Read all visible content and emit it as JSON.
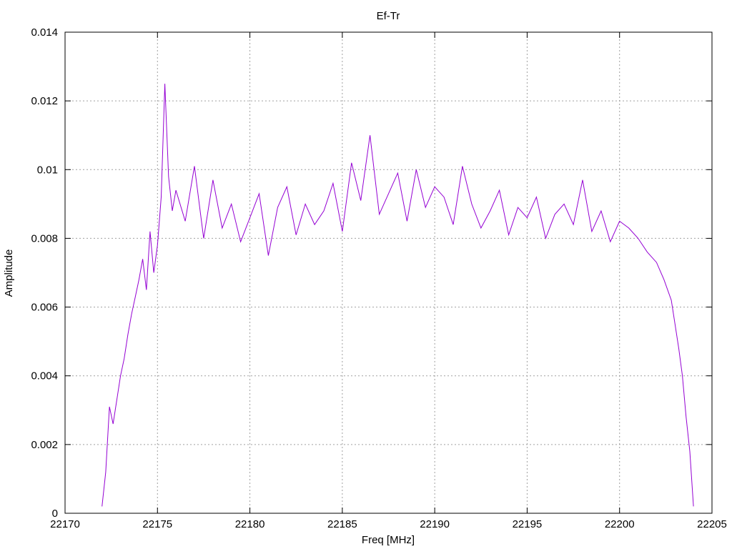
{
  "chart_data": {
    "type": "line",
    "title": "Ef-Tr",
    "xlabel": "Freq [MHz]",
    "ylabel": "Amplitude",
    "xlim": [
      22170,
      22205
    ],
    "ylim": [
      0,
      0.014
    ],
    "xticks": [
      22170,
      22175,
      22180,
      22185,
      22190,
      22195,
      22200,
      22205
    ],
    "xtick_labels": [
      "22170",
      "22175",
      "22180",
      "22185",
      "22190",
      "22195",
      "22200",
      "22205"
    ],
    "yticks": [
      0,
      0.002,
      0.004,
      0.006,
      0.008,
      0.01,
      0.012,
      0.014
    ],
    "ytick_labels": [
      "0",
      "0.002",
      "0.004",
      "0.006",
      "0.008",
      "0.01",
      "0.012",
      "0.014"
    ],
    "grid": true,
    "series": [
      {
        "color": "#9400d3",
        "x": [
          22172.0,
          22172.2,
          22172.4,
          22172.6,
          22172.8,
          22173.0,
          22173.2,
          22173.4,
          22173.6,
          22173.8,
          22174.0,
          22174.2,
          22174.4,
          22174.6,
          22174.8,
          22175.0,
          22175.2,
          22175.4,
          22175.6,
          22175.8,
          22176.0,
          22176.5,
          22177.0,
          22177.5,
          22178.0,
          22178.5,
          22179.0,
          22179.5,
          22180.0,
          22180.5,
          22181.0,
          22181.5,
          22182.0,
          22182.5,
          22183.0,
          22183.5,
          22184.0,
          22184.5,
          22185.0,
          22185.5,
          22186.0,
          22186.5,
          22187.0,
          22187.5,
          22188.0,
          22188.5,
          22189.0,
          22189.5,
          22190.0,
          22190.5,
          22191.0,
          22191.5,
          22192.0,
          22192.5,
          22193.0,
          22193.5,
          22194.0,
          22194.5,
          22195.0,
          22195.5,
          22196.0,
          22196.5,
          22197.0,
          22197.5,
          22198.0,
          22198.5,
          22199.0,
          22199.5,
          22200.0,
          22200.5,
          22201.0,
          22201.5,
          22202.0,
          22202.4,
          22202.8,
          22203.0,
          22203.2,
          22203.4,
          22203.6,
          22203.8,
          22204.0
        ],
        "y": [
          0.0002,
          0.0012,
          0.0031,
          0.0026,
          0.0033,
          0.004,
          0.0045,
          0.0052,
          0.0058,
          0.0063,
          0.0068,
          0.0074,
          0.0065,
          0.0082,
          0.007,
          0.0078,
          0.0092,
          0.0125,
          0.0098,
          0.0088,
          0.0094,
          0.0085,
          0.0101,
          0.008,
          0.0097,
          0.0083,
          0.009,
          0.0079,
          0.0086,
          0.0093,
          0.0075,
          0.0089,
          0.0095,
          0.0081,
          0.009,
          0.0084,
          0.0088,
          0.0096,
          0.0082,
          0.0102,
          0.0091,
          0.011,
          0.0087,
          0.0093,
          0.0099,
          0.0085,
          0.01,
          0.0089,
          0.0095,
          0.0092,
          0.0084,
          0.0101,
          0.009,
          0.0083,
          0.0088,
          0.0094,
          0.0081,
          0.0089,
          0.0086,
          0.0092,
          0.008,
          0.0087,
          0.009,
          0.0084,
          0.0097,
          0.0082,
          0.0088,
          0.0079,
          0.0085,
          0.0083,
          0.008,
          0.0076,
          0.0073,
          0.0068,
          0.0062,
          0.0055,
          0.0048,
          0.004,
          0.0028,
          0.0018,
          0.0002
        ]
      }
    ]
  }
}
